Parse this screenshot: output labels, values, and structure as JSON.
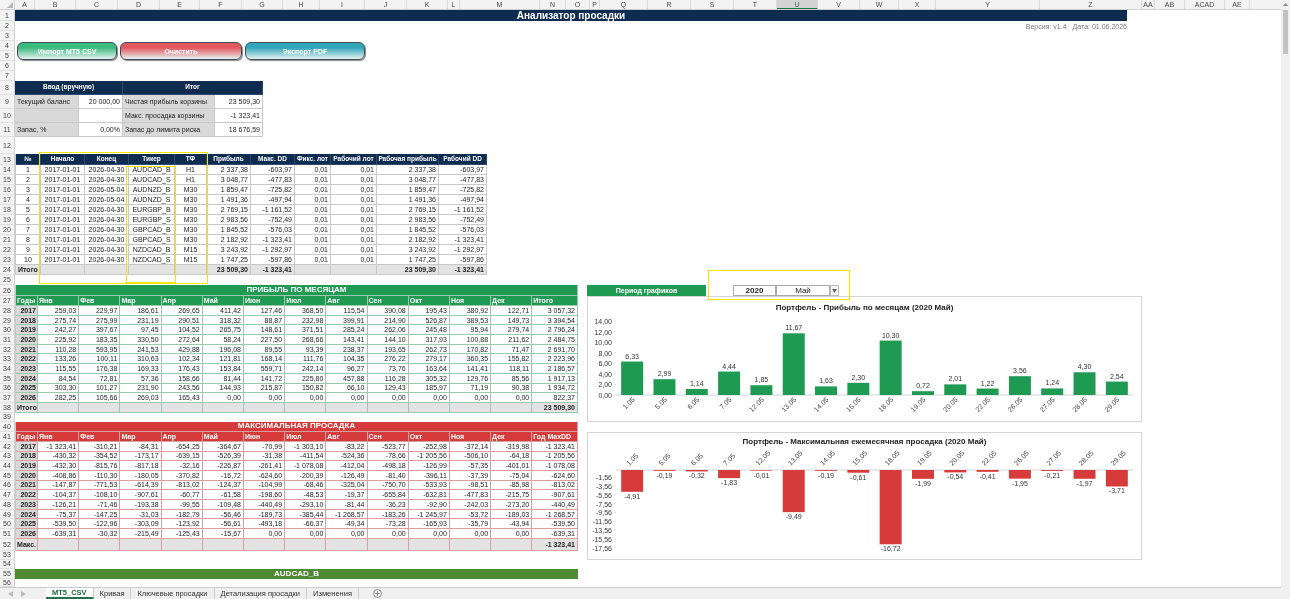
{
  "columns": [
    {
      "label": "A",
      "selected": false
    },
    {
      "label": "B",
      "selected": false
    },
    {
      "label": "C",
      "selected": false
    },
    {
      "label": "D",
      "selected": false
    },
    {
      "label": "E",
      "selected": false
    },
    {
      "label": "F",
      "selected": false
    },
    {
      "label": "G",
      "selected": false
    },
    {
      "label": "H",
      "selected": false
    },
    {
      "label": "I",
      "selected": false
    },
    {
      "label": "J",
      "selected": false
    },
    {
      "label": "K",
      "selected": false
    },
    {
      "label": "L",
      "selected": false
    },
    {
      "label": "M",
      "selected": false
    },
    {
      "label": "N",
      "selected": false
    },
    {
      "label": "O",
      "selected": false
    },
    {
      "label": "P",
      "selected": false
    },
    {
      "label": "Q",
      "selected": false
    },
    {
      "label": "R",
      "selected": false
    },
    {
      "label": "S",
      "selected": false
    },
    {
      "label": "T",
      "selected": false
    },
    {
      "label": "U",
      "selected": true
    },
    {
      "label": "V",
      "selected": false
    },
    {
      "label": "W",
      "selected": false
    },
    {
      "label": "X",
      "selected": false
    },
    {
      "label": "Y",
      "selected": false
    },
    {
      "label": "Z",
      "selected": false
    },
    {
      "label": "AA",
      "selected": false
    },
    {
      "label": "AB",
      "selected": false
    },
    {
      "label": "ACAD",
      "selected": false
    },
    {
      "label": "AE",
      "selected": false
    }
  ],
  "row_numbers": [
    "1",
    "2",
    "3",
    "4",
    "5",
    "6",
    "7",
    "8",
    "9",
    "10",
    "11",
    "12",
    "13",
    "14",
    "15",
    "16",
    "17",
    "18",
    "19",
    "20",
    "21",
    "22",
    "23",
    "24",
    "25",
    "26",
    "27",
    "28",
    "29",
    "30",
    "31",
    "32",
    "33",
    "34",
    "35",
    "36",
    "37",
    "38",
    "39",
    "40",
    "41",
    "42",
    "43",
    "44",
    "45",
    "46",
    "47",
    "48",
    "49",
    "50",
    "51",
    "52",
    "53",
    "54",
    "55",
    "56"
  ],
  "title": "Анализатор просадки",
  "version": "Версия: v1.4",
  "date": "Дата: 01.06.2026",
  "buttons": [
    {
      "label": "Импорт MT5 CSV",
      "color": "#3dba7e"
    },
    {
      "label": "Очистить",
      "color": "#e3585e"
    },
    {
      "label": "Экспорт PDF",
      "color": "#33a6b8"
    }
  ],
  "input_panel": {
    "headers": [
      "Ввод (вручную)",
      "Итог"
    ],
    "rows": [
      {
        "label": "Текущий баланс",
        "value": "20 000,00",
        "result_label": "Чистая прибыль корзины",
        "result": "23 509,30"
      },
      {
        "result_label": "Макс. просадка корзины",
        "result": "-1 323,41"
      },
      {
        "label": "Запас, %",
        "value": "0,00%",
        "result_label": "Запас до лимита риска",
        "result": "18 676,59"
      }
    ]
  },
  "positions_table": {
    "columns": [
      "№",
      "Начало",
      "Конец",
      "Тикер",
      "ТФ",
      "Прибыль",
      "Макс. DD",
      "Фикс. лот",
      "Рабочий лот",
      "Рабочая прибыль",
      "Рабочий DD"
    ],
    "rows": [
      [
        "1",
        "2017-01-01",
        "2026-04-30",
        "AUDCAD_B",
        "H1",
        "2 337,38",
        "-603,97",
        "0,01",
        "0,01",
        "2 337,38",
        "-603,97"
      ],
      [
        "2",
        "2017-01-01",
        "2026-04-30",
        "AUDCAD_S",
        "H1",
        "3 048,77",
        "-477,83",
        "0,01",
        "0,01",
        "3 048,77",
        "-477,83"
      ],
      [
        "3",
        "2017-01-01",
        "2026-05-04",
        "AUDNZD_B",
        "M30",
        "1 859,47",
        "-725,82",
        "0,01",
        "0,01",
        "1 859,47",
        "-725,82"
      ],
      [
        "4",
        "2017-01-01",
        "2026-05-04",
        "AUDNZD_S",
        "M30",
        "1 491,36",
        "-497,94",
        "0,01",
        "0,01",
        "1 491,36",
        "-497,94"
      ],
      [
        "5",
        "2017-01-01",
        "2026-04-30",
        "EURGBP_B",
        "M30",
        "2 769,15",
        "-1 161,52",
        "0,01",
        "0,01",
        "2 769,15",
        "-1 161,52"
      ],
      [
        "6",
        "2017-01-01",
        "2026-04-30",
        "EURGBP_S",
        "M30",
        "2 983,56",
        "-752,49",
        "0,01",
        "0,01",
        "2 983,56",
        "-752,49"
      ],
      [
        "7",
        "2017-01-01",
        "2026-04-30",
        "GBPCAD_B",
        "M30",
        "1 845,52",
        "-576,03",
        "0,01",
        "0,01",
        "1 845,52",
        "-576,03"
      ],
      [
        "8",
        "2017-01-01",
        "2026-04-30",
        "GBPCAD_S",
        "M30",
        "2 182,92",
        "-1 323,41",
        "0,01",
        "0,01",
        "2 182,92",
        "-1 323,41"
      ],
      [
        "9",
        "2017-01-01",
        "2026-04-30",
        "NZDCAD_B",
        "M15",
        "3 243,92",
        "-1 292,97",
        "0,01",
        "0,01",
        "3 243,92",
        "-1 292,97"
      ],
      [
        "10",
        "2017-01-01",
        "2026-04-30",
        "NZDCAD_S",
        "M15",
        "1 747,25",
        "-597,86",
        "0,01",
        "0,01",
        "1 747,25",
        "-597,86"
      ]
    ],
    "total": {
      "label": "Итого",
      "profit": "23 509,30",
      "max_dd": "-1 323,41",
      "work_profit": "23 509,30",
      "work_dd": "-1 323,41"
    }
  },
  "monthly_profit": {
    "title": "ПРИБЫЛЬ ПО МЕСЯЦАМ",
    "columns": [
      "Годы",
      "Янв",
      "Фев",
      "Мар",
      "Апр",
      "Май",
      "Июн",
      "Июл",
      "Авг",
      "Сен",
      "Окт",
      "Ноя",
      "Дек",
      "Итого"
    ],
    "rows": [
      [
        "2017",
        "259,03",
        "229,97",
        "186,61",
        "269,65",
        "411,42",
        "127,46",
        "368,50",
        "115,54",
        "390,08",
        "195,43",
        "380,92",
        "122,71",
        "3 057,32"
      ],
      [
        "2018",
        "275,74",
        "275,99",
        "231,19",
        "290,51",
        "318,32",
        "88,87",
        "232,98",
        "399,91",
        "214,90",
        "526,87",
        "389,53",
        "149,73",
        "3 394,54"
      ],
      [
        "2019",
        "242,27",
        "397,67",
        "97,45",
        "104,52",
        "265,75",
        "148,61",
        "371,51",
        "285,24",
        "262,06",
        "245,48",
        "95,94",
        "279,74",
        "2 796,24"
      ],
      [
        "2020",
        "225,92",
        "183,35",
        "330,50",
        "272,64",
        "58,24",
        "227,50",
        "268,66",
        "143,41",
        "144,10",
        "317,93",
        "100,88",
        "211,62",
        "2 484,75"
      ],
      [
        "2021",
        "110,28",
        "593,95",
        "241,53",
        "429,88",
        "196,08",
        "89,55",
        "93,39",
        "238,37",
        "193,65",
        "262,73",
        "170,82",
        "71,47",
        "2 691,70"
      ],
      [
        "2022",
        "133,26",
        "100,11",
        "310,63",
        "102,34",
        "121,81",
        "168,14",
        "111,76",
        "104,35",
        "276,22",
        "279,17",
        "360,35",
        "155,82",
        "2 223,96"
      ],
      [
        "2023",
        "115,55",
        "176,38",
        "169,33",
        "176,43",
        "153,84",
        "559,71",
        "242,14",
        "96,27",
        "73,76",
        "163,64",
        "141,41",
        "118,11",
        "2 186,57"
      ],
      [
        "2024",
        "84,54",
        "72,81",
        "57,36",
        "158,66",
        "81,44",
        "141,72",
        "225,80",
        "457,88",
        "116,28",
        "305,32",
        "129,76",
        "85,56",
        "1 917,13"
      ],
      [
        "2025",
        "303,30",
        "101,27",
        "231,90",
        "243,56",
        "144,93",
        "215,87",
        "150,82",
        "66,10",
        "129,43",
        "185,97",
        "71,19",
        "90,38",
        "1 934,72"
      ],
      [
        "2026",
        "282,25",
        "105,66",
        "269,03",
        "165,43",
        "0,00",
        "0,00",
        "0,00",
        "0,00",
        "0,00",
        "0,00",
        "0,00",
        "0,00",
        "822,37"
      ]
    ],
    "total": {
      "label": "Итого",
      "value": "23 509,30"
    }
  },
  "monthly_drawdown": {
    "title": "МАКСИМАЛЬНАЯ ПРОСАДКА",
    "columns": [
      "Годы",
      "Янв",
      "Фев",
      "Мар",
      "Апр",
      "Май",
      "Июн",
      "Июл",
      "Авг",
      "Сен",
      "Окт",
      "Ноя",
      "Дек",
      "Год MaxDD"
    ],
    "rows": [
      [
        "2017",
        "-1 323,41",
        "-310,21",
        "-84,31",
        "-654,25",
        "-364,67",
        "-70,99",
        "-1 303,10",
        "-83,22",
        "-523,77",
        "-252,98",
        "-372,14",
        "-319,98",
        "-1 323,41"
      ],
      [
        "2018",
        "-430,32",
        "-354,52",
        "-173,17",
        "-639,15",
        "-526,39",
        "-31,38",
        "-411,54",
        "-524,36",
        "-78,66",
        "-1 205,56",
        "-506,10",
        "-64,18",
        "-1 205,56"
      ],
      [
        "2019",
        "-432,30",
        "-815,76",
        "-817,18",
        "-32,16",
        "-226,87",
        "-261,41",
        "-1 078,08",
        "-412,04",
        "-498,18",
        "-126,99",
        "-57,35",
        "-401,01",
        "-1 078,08"
      ],
      [
        "2020",
        "-408,86",
        "-110,30",
        "-180,05",
        "-370,82",
        "-16,72",
        "-624,60",
        "-200,39",
        "-126,49",
        "-81,40",
        "-396,11",
        "-37,39",
        "-75,04",
        "-624,60"
      ],
      [
        "2021",
        "-147,87",
        "-771,53",
        "-614,39",
        "-813,02",
        "-124,37",
        "-104,99",
        "-68,46",
        "-325,04",
        "-750,70",
        "-533,93",
        "-98,51",
        "-85,98",
        "-813,02"
      ],
      [
        "2022",
        "-104,37",
        "-108,10",
        "-907,61",
        "-60,77",
        "-61,58",
        "-198,60",
        "-48,53",
        "-19,37",
        "-655,84",
        "-632,81",
        "-477,83",
        "-215,75",
        "-907,61"
      ],
      [
        "2023",
        "-126,21",
        "-71,46",
        "-193,38",
        "-99,55",
        "-109,48",
        "-440,49",
        "-293,10",
        "-81,44",
        "-36,23",
        "-92,90",
        "-242,03",
        "-273,20",
        "-440,49"
      ],
      [
        "2024",
        "-75,37",
        "-147,25",
        "-31,03",
        "-182,79",
        "-56,46",
        "-189,73",
        "-385,44",
        "-1 268,57",
        "-183,26",
        "-1 245,97",
        "-53,72",
        "-189,03",
        "-1 268,57"
      ],
      [
        "2025",
        "-539,50",
        "-122,96",
        "-303,09",
        "-123,92",
        "-56,61",
        "-493,18",
        "-66,37",
        "-49,34",
        "-73,28",
        "-165,93",
        "-35,79",
        "-43,94",
        "-539,50"
      ],
      [
        "2026",
        "-639,31",
        "-30,32",
        "-215,49",
        "-125,43",
        "-15,67",
        "0,00",
        "0,00",
        "0,00",
        "0,00",
        "0,00",
        "0,00",
        "0,00",
        "-639,31"
      ]
    ],
    "total": {
      "label": "Макс.",
      "value": "-1 323,41"
    }
  },
  "section_bar": "AUDCAD_B",
  "chart_period": {
    "label": "Период графиков",
    "year": "2020",
    "month": "Май"
  },
  "profit_chart": {
    "chart_data": {
      "type": "bar",
      "title": "Портфель - Прибыль по месяцам (2020 Май)",
      "categories": [
        "1.05",
        "5.05",
        "6.05",
        "7.05",
        "12.05",
        "13.05",
        "14.05",
        "15.05",
        "18.05",
        "19.05",
        "20.05",
        "22.05",
        "26.05",
        "27.05",
        "28.05",
        "29.05"
      ],
      "values": [
        6.33,
        2.99,
        1.14,
        4.44,
        1.85,
        11.67,
        1.63,
        2.3,
        10.3,
        0.72,
        2.01,
        1.22,
        3.56,
        1.24,
        4.3,
        2.54
      ],
      "value_labels": [
        "6,33",
        "2,99",
        "1,14",
        "4,44",
        "1,85",
        "11,67",
        "1,63",
        "2,30",
        "10,30",
        "0,72",
        "2,01",
        "1,22",
        "3,56",
        "1,24",
        "4,30",
        "2,54"
      ],
      "ylim": [
        0,
        14
      ],
      "yticks": [
        {
          "value": 0,
          "label": "0,00"
        },
        {
          "value": 2,
          "label": "2,00"
        },
        {
          "value": 4,
          "label": "4,00"
        },
        {
          "value": 6,
          "label": "6,00"
        },
        {
          "value": 8,
          "label": "8,00"
        },
        {
          "value": 10,
          "label": "10,00"
        },
        {
          "value": 12,
          "label": "12,00"
        },
        {
          "value": 14,
          "label": "14,00"
        }
      ]
    }
  },
  "drawdown_chart": {
    "chart_data": {
      "type": "bar",
      "title": "Портфель - Максимальная ежемесячная просадка (2020 Май)",
      "categories": [
        "1.05",
        "5.05",
        "6.05",
        "7.05",
        "12.05",
        "13.05",
        "14.05",
        "15.05",
        "18.05",
        "19.05",
        "20.05",
        "22.05",
        "26.05",
        "27.05",
        "28.05",
        "29.05"
      ],
      "values": [
        -4.91,
        -0.19,
        -0.32,
        -1.83,
        -0.01,
        -9.49,
        -0.19,
        -0.61,
        -16.72,
        -1.99,
        -0.54,
        -0.41,
        -1.95,
        -0.21,
        -1.97,
        -3.71
      ],
      "value_labels": [
        "-4,91",
        "-0,19",
        "-0,32",
        "-1,83",
        "-0,01",
        "-9,49",
        "-0,19",
        "-0,61",
        "-16,72",
        "-1,99",
        "-0,54",
        "-0,41",
        "-1,95",
        "-0,21",
        "-1,97",
        "-3,71"
      ],
      "ylim": [
        -17.56,
        0
      ],
      "yticks": [
        {
          "value": -1.56,
          "label": "-1,56"
        },
        {
          "value": -3.56,
          "label": "-3,56"
        },
        {
          "value": -5.56,
          "label": "-5,56"
        },
        {
          "value": -7.56,
          "label": "-7,56"
        },
        {
          "value": -9.56,
          "label": "-9,56"
        },
        {
          "value": -11.56,
          "label": "-11,56"
        },
        {
          "value": -13.56,
          "label": "-13,56"
        },
        {
          "value": -15.56,
          "label": "-15,56"
        },
        {
          "value": -17.56,
          "label": "-17,56"
        }
      ]
    }
  },
  "highlight_frames": [
    {
      "kind": "columns"
    },
    {
      "kind": "ticker"
    },
    {
      "kind": "period"
    }
  ],
  "sheet_tabs": [
    {
      "label": "MT5_CSV",
      "selected": true
    },
    {
      "label": "Кривая",
      "selected": false
    },
    {
      "label": "Ключевые просадки",
      "selected": false
    },
    {
      "label": "Детализация просадки",
      "selected": false
    },
    {
      "label": "Изменения",
      "selected": false
    }
  ]
}
